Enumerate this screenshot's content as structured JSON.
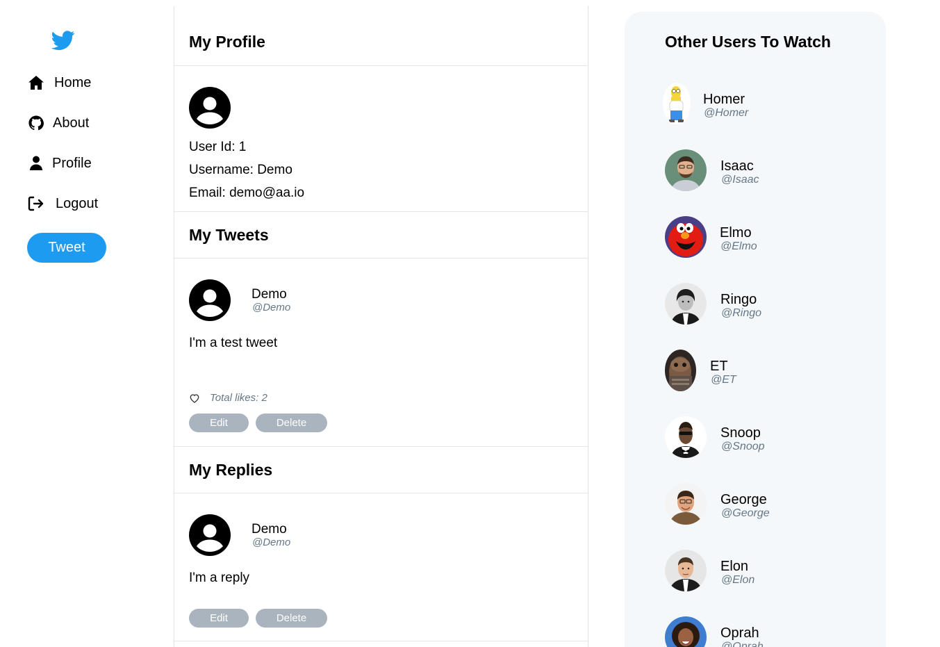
{
  "nav": {
    "items": [
      {
        "label": "Home",
        "icon": "home-icon"
      },
      {
        "label": "About",
        "icon": "github-icon"
      },
      {
        "label": "Profile",
        "icon": "user-icon"
      },
      {
        "label": "Logout",
        "icon": "logout-icon"
      }
    ],
    "tweet_button": "Tweet"
  },
  "profile": {
    "title": "My Profile",
    "user_id": "User Id: 1",
    "username": "Username: Demo",
    "email": "Email: demo@aa.io"
  },
  "tweets": {
    "title": "My Tweets",
    "items": [
      {
        "name": "Demo",
        "handle": "@Demo",
        "content": "I'm a test tweet",
        "likes": "Total likes: 2",
        "edit_label": "Edit",
        "delete_label": "Delete"
      }
    ]
  },
  "replies": {
    "title": "My Replies",
    "items": [
      {
        "name": "Demo",
        "handle": "@Demo",
        "content": "I'm a reply",
        "edit_label": "Edit",
        "delete_label": "Delete"
      }
    ]
  },
  "suggestions": {
    "title": "Other Users To Watch",
    "users": [
      {
        "name": "Homer",
        "handle": "@Homer"
      },
      {
        "name": "Isaac",
        "handle": "@Isaac"
      },
      {
        "name": "Elmo",
        "handle": "@Elmo"
      },
      {
        "name": "Ringo",
        "handle": "@Ringo"
      },
      {
        "name": "ET",
        "handle": "@ET"
      },
      {
        "name": "Snoop",
        "handle": "@Snoop"
      },
      {
        "name": "George",
        "handle": "@George"
      },
      {
        "name": "Elon",
        "handle": "@Elon"
      },
      {
        "name": "Oprah",
        "handle": "@Oprah"
      }
    ]
  },
  "colors": {
    "brand": "#1d9bf0",
    "button_grey": "#aab4bf",
    "handle_grey": "#657786",
    "panel_bg": "#f5f8fa"
  }
}
